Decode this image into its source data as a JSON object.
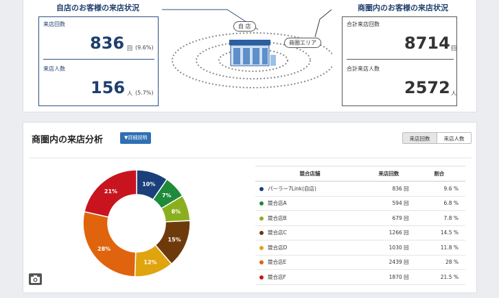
{
  "own_store": {
    "title": "自店のお客様の来店状況",
    "visits_label": "来店回数",
    "visits_value": "836",
    "visits_unit": "回",
    "visits_pct": "(9.6%)",
    "visitors_label": "来店人数",
    "visitors_value": "156",
    "visitors_unit": "人",
    "visitors_pct": "(5.7%)"
  },
  "area": {
    "title": "商圏内のお客様の来店状況",
    "visits_label": "合計来店回数",
    "visits_value": "8714",
    "visits_unit": "回",
    "visitors_label": "合計来店人数",
    "visitors_value": "2572",
    "visitors_unit": "人"
  },
  "illustration": {
    "store_tag": "自 店",
    "area_tag": "商圏エリア"
  },
  "analysis": {
    "title": "商圏内の来店分析",
    "detail_button": "▼詳細説明",
    "toggle_visits": "来店回数",
    "toggle_visitors": "来店人数",
    "headers": {
      "name": "競合店舗",
      "visits": "来店回数",
      "ratio": "割合"
    },
    "rows": [
      {
        "name": "パーラー7Link(自店)",
        "visits": "836 回",
        "ratio": "9.6 %"
      },
      {
        "name": "競合店A",
        "visits": "594 回",
        "ratio": "6.8 %"
      },
      {
        "name": "競合店B",
        "visits": "679 回",
        "ratio": "7.8 %"
      },
      {
        "name": "競合店C",
        "visits": "1266 回",
        "ratio": "14.5 %"
      },
      {
        "name": "競合店D",
        "visits": "1030 回",
        "ratio": "11.8 %"
      },
      {
        "name": "競合店E",
        "visits": "2439 回",
        "ratio": "28 %"
      },
      {
        "name": "競合店F",
        "visits": "1870 回",
        "ratio": "21.5 %"
      }
    ]
  },
  "colors": {
    "primary": "#1f3f6e",
    "button": "#2f6fb3",
    "series": [
      "#1a3f7a",
      "#1e8a3a",
      "#8aaf1e",
      "#6e3a0c",
      "#e0a40e",
      "#e0640e",
      "#c8141e"
    ]
  },
  "chart_data": {
    "type": "pie",
    "categories": [
      "パーラー7Link(自店)",
      "競合店A",
      "競合店B",
      "競合店C",
      "競合店D",
      "競合店E",
      "競合店F"
    ],
    "values": [
      9.6,
      6.8,
      7.8,
      14.5,
      11.8,
      28,
      21.5
    ],
    "labels": [
      "10%",
      "7%",
      "8%",
      "15%",
      "12%",
      "28%",
      "21%"
    ],
    "donut": true
  }
}
